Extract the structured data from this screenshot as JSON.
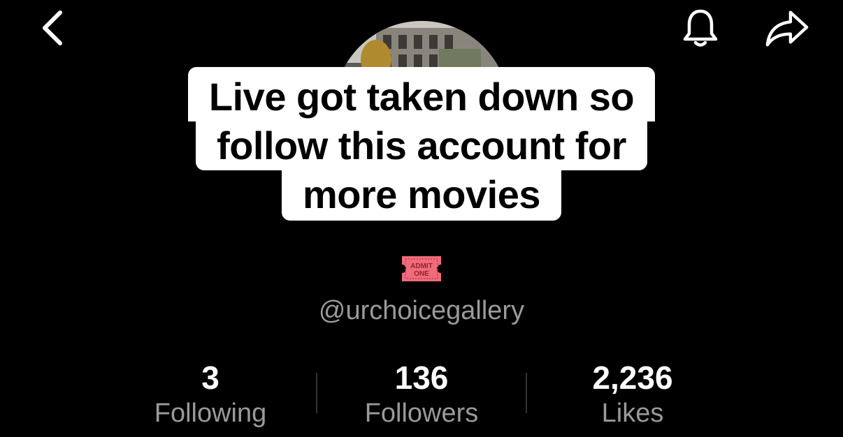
{
  "header": {
    "back_icon": "chevron-left-icon",
    "notify_icon": "bell-icon",
    "share_icon": "share-arrow-icon"
  },
  "caption": {
    "line1": "Live got taken down so",
    "line2": "follow this account for",
    "line3": "more movies"
  },
  "badge": {
    "icon": "admit-one-ticket-icon",
    "line1": "ADMIT",
    "line2": "ONE",
    "color": "#f06b7b"
  },
  "profile": {
    "username": "@urchoicegallery"
  },
  "stats": [
    {
      "value": "3",
      "label": "Following"
    },
    {
      "value": "136",
      "label": "Followers"
    },
    {
      "value": "2,236",
      "label": "Likes"
    }
  ]
}
